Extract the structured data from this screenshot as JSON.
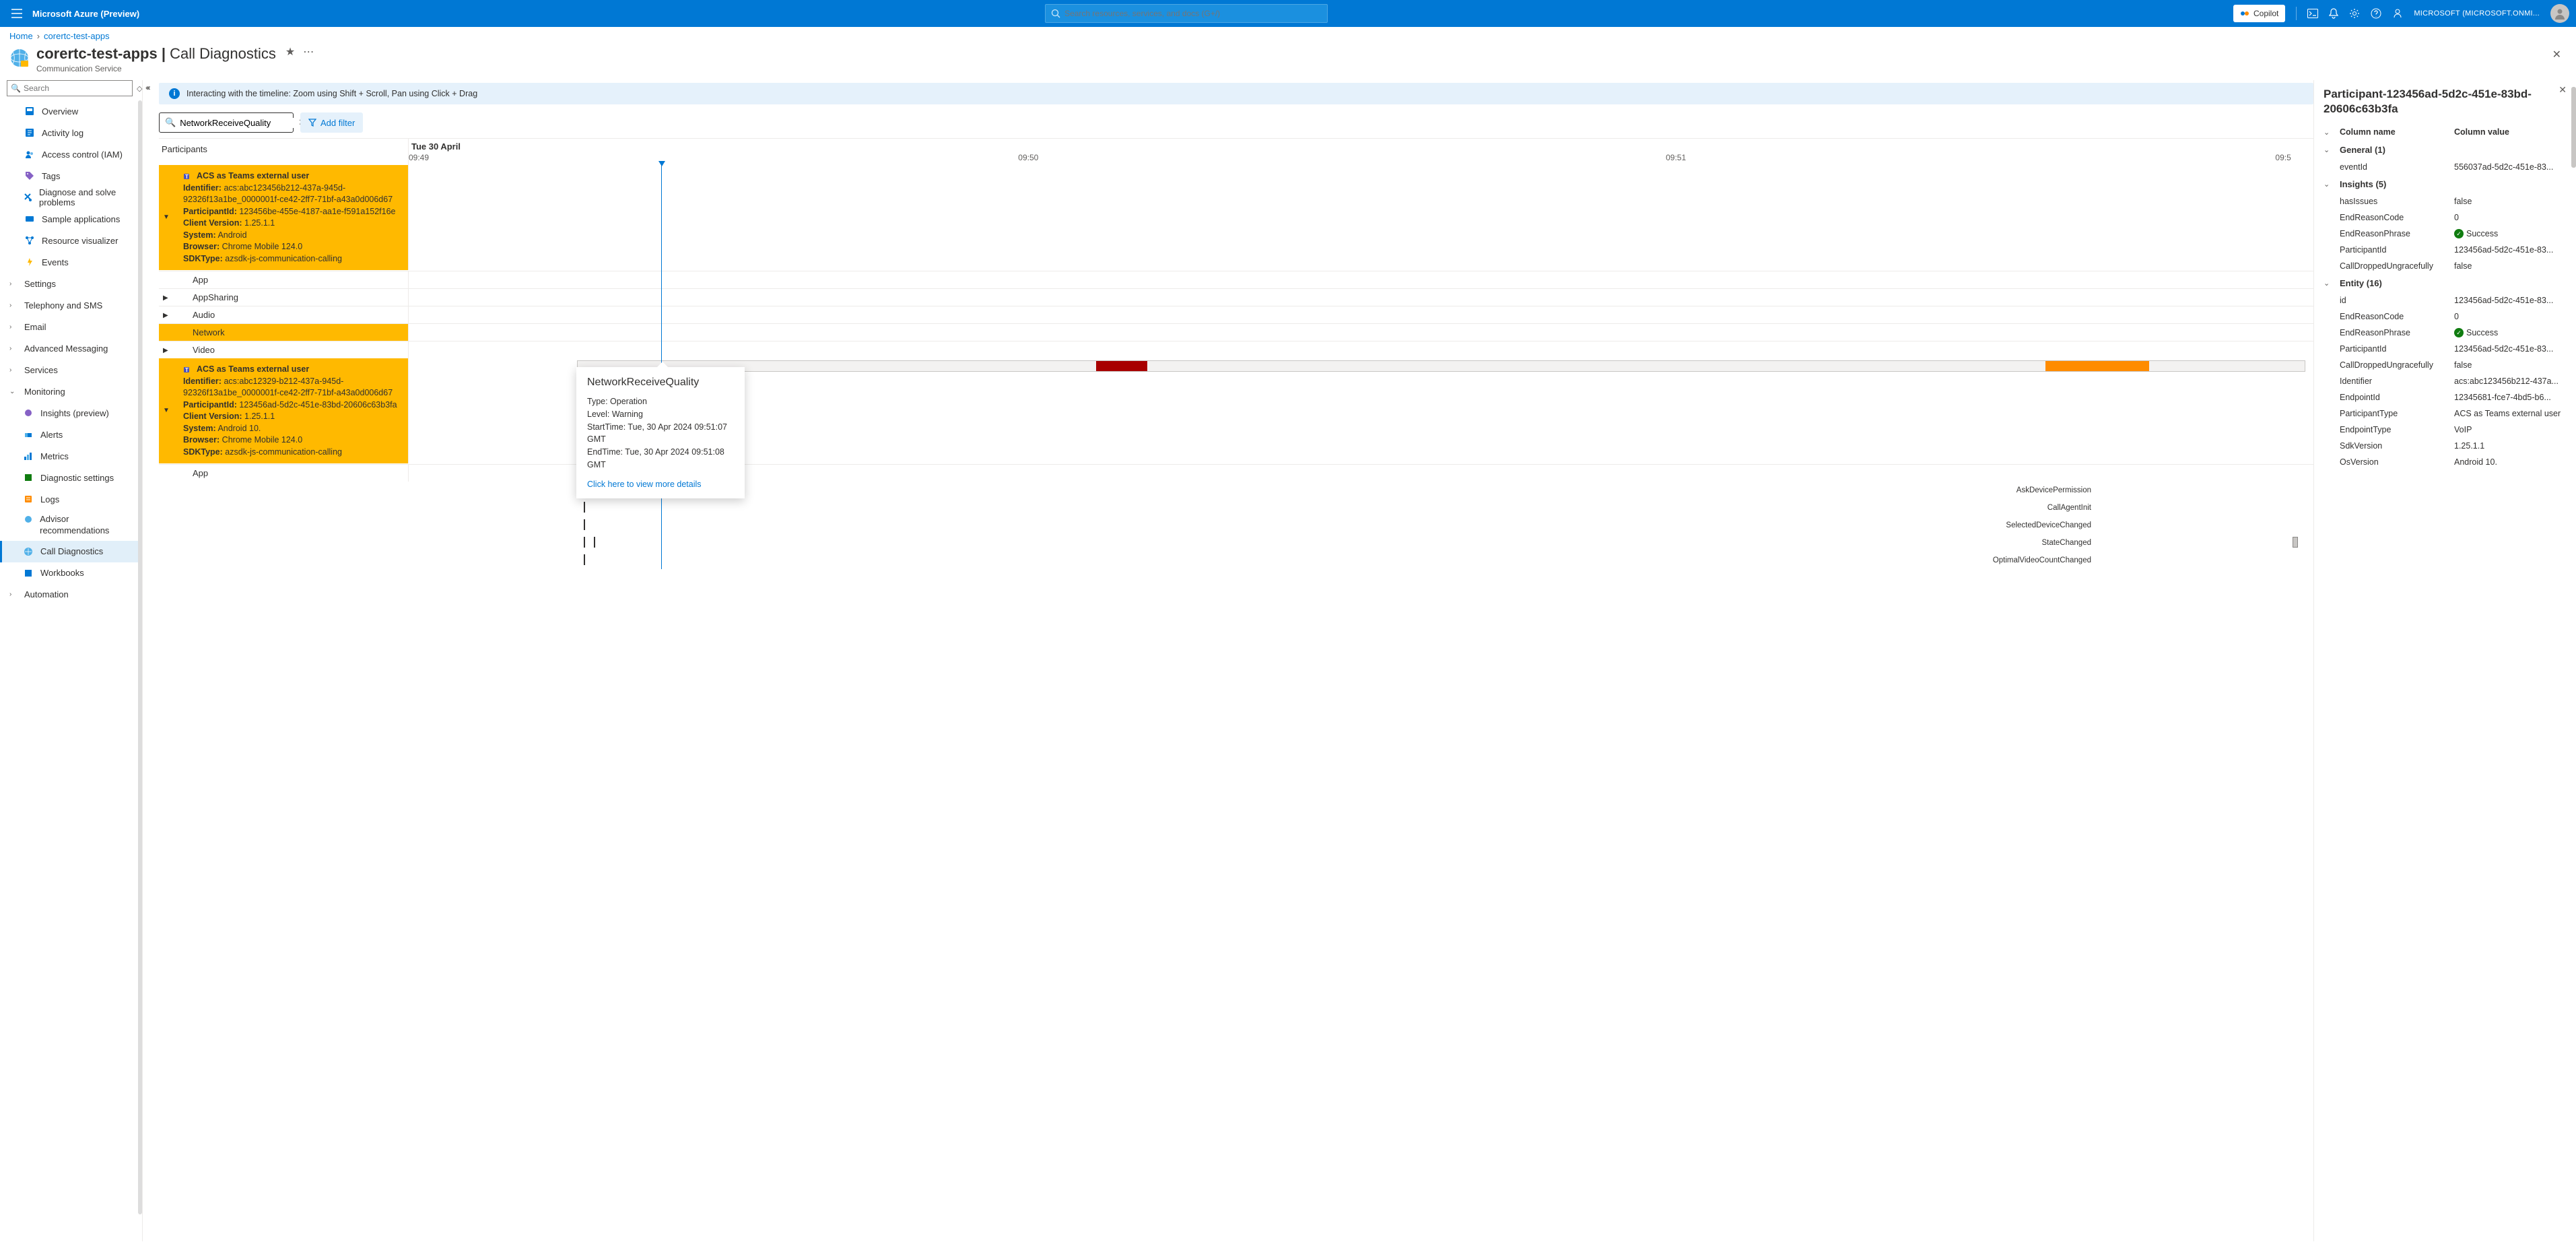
{
  "topbar": {
    "brand": "Microsoft Azure (Preview)",
    "search_placeholder": "Search resources, services, and docs (G+/)",
    "copilot": "Copilot",
    "tenant": "MICROSOFT (MICROSOFT.ONMI..."
  },
  "breadcrumbs": {
    "home": "Home",
    "current": "corertc-test-apps"
  },
  "page": {
    "title_main": "corertc-test-apps",
    "title_sep": " | ",
    "title_sub": "Call Diagnostics",
    "subtitle": "Communication Service"
  },
  "sidebar": {
    "search_placeholder": "Search",
    "items": {
      "overview": "Overview",
      "activity": "Activity log",
      "iam": "Access control (IAM)",
      "tags": "Tags",
      "diagnose": "Diagnose and solve problems",
      "sample": "Sample applications",
      "resvis": "Resource visualizer",
      "events": "Events",
      "settings": "Settings",
      "telephony": "Telephony and SMS",
      "email": "Email",
      "advmsg": "Advanced Messaging",
      "services": "Services",
      "monitoring": "Monitoring",
      "insights": "Insights (preview)",
      "alerts": "Alerts",
      "metrics": "Metrics",
      "diagset": "Diagnostic settings",
      "logs": "Logs",
      "advisor": "Advisor recommendations",
      "calldiag": "Call Diagnostics",
      "workbooks": "Workbooks",
      "automation": "Automation"
    }
  },
  "banner": "Interacting with the timeline: Zoom using Shift + Scroll, Pan using Click + Drag",
  "filter": {
    "value": "NetworkReceiveQuality",
    "add": "Add filter"
  },
  "timeline": {
    "participants_header": "Participants",
    "date": "Tue 30 April",
    "ticks": [
      "09:49",
      "09:50",
      "09:51",
      "09:5"
    ]
  },
  "participant1": {
    "title": "ACS as Teams external user",
    "id_label": "Identifier:",
    "id_val": "acs:abc123456b212-437a-945d-92326f13a1be_0000001f-ce42-2ff7-71bf-a43a0d006d67",
    "pid_label": "ParticipantId:",
    "pid_val": "123456be-455e-4187-aa1e-f591a152f16e",
    "cv_label": "Client Version:",
    "cv_val": "1.25.1.1",
    "sys_label": "System:",
    "sys_val": "Android",
    "br_label": "Browser:",
    "br_val": "Chrome Mobile 124.0",
    "sdk_label": "SDKType:",
    "sdk_val": "azsdk-js-communication-calling",
    "rows": {
      "app": "App",
      "appsharing": "AppSharing",
      "audio": "Audio",
      "network": "Network",
      "video": "Video"
    }
  },
  "participant2": {
    "title": "ACS as Teams external user",
    "id_label": "Identifier:",
    "id_val": "acs:abc12329-b212-437a-945d-92326f13a1be_0000001f-ce42-2ff7-71bf-a43a0d006d67",
    "pid_label": "ParticipantId:",
    "pid_val": "123456ad-5d2c-451e-83bd-20606c63b3fa",
    "cv_label": "Client Version:",
    "cv_val": "1.25.1.1",
    "sys_label": "System:",
    "sys_val": "Android 10.",
    "br_label": "Browser:",
    "br_val": "Chrome Mobile 124.0",
    "sdk_label": "SDKType:",
    "sdk_val": "azsdk-js-communication-calling",
    "rows": {
      "app": "App"
    }
  },
  "events": {
    "e1": "AskDevicePermission",
    "e2": "CallAgentInit",
    "e3": "SelectedDeviceChanged",
    "e4": "StateChanged",
    "e5": "OptimalVideoCountChanged"
  },
  "tooltip": {
    "title": "NetworkReceiveQuality",
    "type": "Type: Operation",
    "level": "Level: Warning",
    "start": "StartTime: Tue, 30 Apr 2024 09:51:07 GMT",
    "end": "EndTime: Tue, 30 Apr 2024 09:51:08 GMT",
    "link": "Click here to view more details"
  },
  "details": {
    "title": "Participant-123456ad-5d2c-451e-83bd-20606c63b3fa",
    "col_name": "Column name",
    "col_val": "Column value",
    "general": "General (1)",
    "insights": "Insights (5)",
    "entity": "Entity (16)",
    "kv": {
      "eventId": {
        "k": "eventId",
        "v": "556037ad-5d2c-451e-83..."
      },
      "hasIssues": {
        "k": "hasIssues",
        "v": "false"
      },
      "endReason": {
        "k": "EndReasonCode",
        "v": "0"
      },
      "endPhrase": {
        "k": "EndReasonPhrase",
        "v": "Success"
      },
      "pid": {
        "k": "ParticipantId",
        "v": "123456ad-5d2c-451e-83..."
      },
      "dropped": {
        "k": "CallDroppedUngracefully",
        "v": "false"
      },
      "id": {
        "k": "id",
        "v": "123456ad-5d2c-451e-83..."
      },
      "endReason2": {
        "k": "EndReasonCode",
        "v": "0"
      },
      "endPhrase2": {
        "k": "EndReasonPhrase",
        "v": "Success"
      },
      "pid2": {
        "k": "ParticipantId",
        "v": "123456ad-5d2c-451e-83..."
      },
      "dropped2": {
        "k": "CallDroppedUngracefully",
        "v": "false"
      },
      "identifier": {
        "k": "Identifier",
        "v": "acs:abc123456b212-437a..."
      },
      "endpointId": {
        "k": "EndpointId",
        "v": "12345681-fce7-4bd5-b6..."
      },
      "ptype": {
        "k": "ParticipantType",
        "v": "ACS as Teams external user"
      },
      "etype": {
        "k": "EndpointType",
        "v": "VoIP"
      },
      "sdkv": {
        "k": "SdkVersion",
        "v": "1.25.1.1"
      },
      "osv": {
        "k": "OsVersion",
        "v": "Android 10."
      }
    }
  }
}
